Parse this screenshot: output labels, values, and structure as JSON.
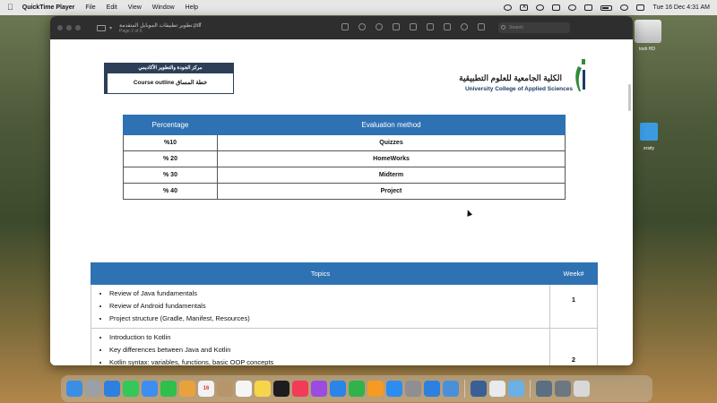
{
  "menubar": {
    "app_name": "QuickTime Player",
    "menus": [
      "File",
      "Edit",
      "View",
      "Window",
      "Help"
    ],
    "clock": "Tue 16 Dec 4:31 AM"
  },
  "desktop": {
    "hd_label": "tosh HD",
    "folder_label": "ersity"
  },
  "window": {
    "filename": "تطوير تطبيقات الموبايل المتقدمة.pdf",
    "page_indicator": "Page 2 of 6",
    "search_placeholder": "Search"
  },
  "doc_header": {
    "center_name": "مركز الجودة والتطوير الأكاديمي",
    "course_outline": "Course outline خطة المساق",
    "college_ar": "الكلية الجامعية للعلوم التطبيقية",
    "college_en": "University College of Applied Sciences"
  },
  "eval_table": {
    "headers": [
      "Percentage",
      "Evaluation method"
    ],
    "rows": [
      {
        "pct": "%10",
        "method": "Quizzes"
      },
      {
        "pct": "% 20",
        "method": "HomeWorks"
      },
      {
        "pct": "% 30",
        "method": "Midterm"
      },
      {
        "pct": "% 40",
        "method": "Project"
      }
    ]
  },
  "topics_table": {
    "headers": [
      "Topics",
      "Week#"
    ],
    "rows": [
      {
        "items": [
          "Review of Java fundamentals",
          "Review of Android fundamentals",
          "Project structure (Gradle, Manifest, Resources)"
        ],
        "week": "1"
      },
      {
        "items": [
          "Introduction to Kotlin",
          "Key differences between Java and Kotlin",
          "Kotlin syntax: variables, functions, basic OOP concepts"
        ],
        "week": "2"
      }
    ]
  },
  "dock": {
    "calendar_day": "16",
    "apps": [
      {
        "name": "finder-icon",
        "color": "#3b8ee6"
      },
      {
        "name": "launchpad-icon",
        "color": "#9aa0a6"
      },
      {
        "name": "safari-icon",
        "color": "#2d7fe0"
      },
      {
        "name": "messages-icon",
        "color": "#34c759"
      },
      {
        "name": "mail-icon",
        "color": "#3d8ef0"
      },
      {
        "name": "facetime-icon",
        "color": "#2fbf4a"
      },
      {
        "name": "photos-icon",
        "color": "#e9a23b"
      },
      {
        "name": "calendar-icon",
        "color": "#f2f2f2"
      },
      {
        "name": "contacts-icon",
        "color": "#b8946a"
      },
      {
        "name": "reminders-icon",
        "color": "#f5f5f5"
      },
      {
        "name": "notes-icon",
        "color": "#f7d54a"
      },
      {
        "name": "tv-icon",
        "color": "#1d1d1f"
      },
      {
        "name": "music-icon",
        "color": "#f23b57"
      },
      {
        "name": "podcasts-icon",
        "color": "#9b4be0"
      },
      {
        "name": "keynote-icon",
        "color": "#2b84e8"
      },
      {
        "name": "numbers-icon",
        "color": "#30b34b"
      },
      {
        "name": "pages-icon",
        "color": "#f59b23"
      },
      {
        "name": "appstore-icon",
        "color": "#2d8cf0"
      },
      {
        "name": "settings-icon",
        "color": "#8e8e93"
      },
      {
        "name": "xcode-icon",
        "color": "#2d7fe0"
      },
      {
        "name": "preview-icon",
        "color": "#4a90d9"
      }
    ],
    "recent_apps": [
      {
        "name": "quicktime-icon",
        "color": "#3a5f95"
      },
      {
        "name": "chrome-icon",
        "color": "#e8eaed"
      },
      {
        "name": "generic-app-icon",
        "color": "#6bb0e6"
      }
    ],
    "tray": [
      {
        "name": "downloads-stack-icon",
        "color": "#5a6f82"
      },
      {
        "name": "documents-stack-icon",
        "color": "#6d7782"
      },
      {
        "name": "trash-icon",
        "color": "#d8d8d8"
      }
    ]
  }
}
